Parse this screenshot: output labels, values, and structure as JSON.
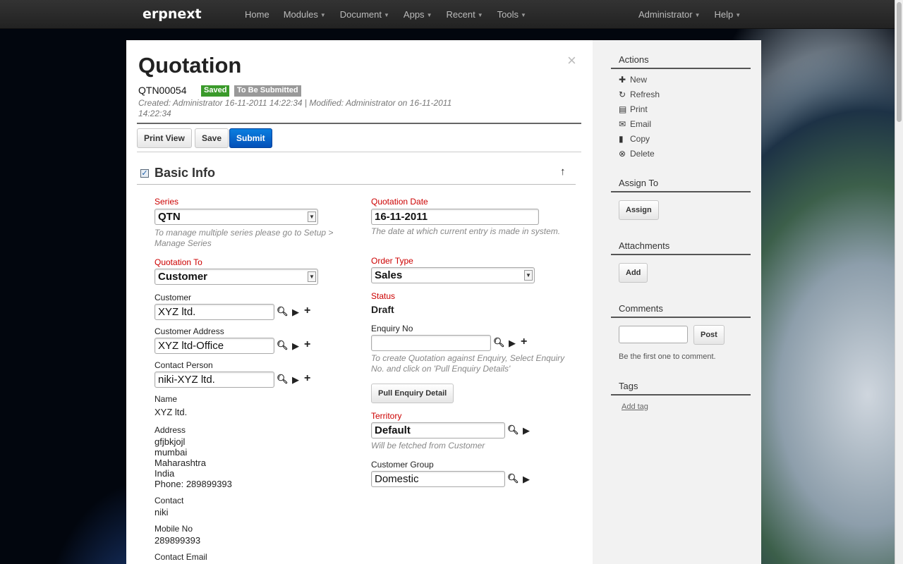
{
  "app": {
    "brand": "erpnext",
    "nav_left": [
      "Home",
      "Modules",
      "Document",
      "Apps",
      "Recent",
      "Tools"
    ],
    "nav_right": [
      "Administrator",
      "Help"
    ]
  },
  "doc": {
    "title": "Quotation",
    "name": "QTN00054",
    "status_saved": "Saved",
    "status_next": "To Be Submitted",
    "meta": "Created: Administrator 16-11-2011 14:22:34 | Modified: Administrator on 16-11-2011 14:22:34",
    "buttons": {
      "print_view": "Print View",
      "save": "Save",
      "submit": "Submit"
    },
    "section_title": "Basic Info"
  },
  "left": {
    "series_label": "Series",
    "series_value": "QTN",
    "series_hint": "To manage multiple series please go to Setup > Manage Series",
    "quotation_to_label": "Quotation To",
    "quotation_to_value": "Customer",
    "customer_label": "Customer",
    "customer_value": "XYZ ltd.",
    "customer_address_label": "Customer Address",
    "customer_address_value": "XYZ ltd-Office",
    "contact_person_label": "Contact Person",
    "contact_person_value": "niki-XYZ ltd.",
    "name_label": "Name",
    "name_value": "XYZ ltd.",
    "address_label": "Address",
    "address_lines": [
      "gfjbkjojl",
      "mumbai",
      "Maharashtra",
      "India",
      "Phone: 289899393"
    ],
    "contact_label": "Contact",
    "contact_value": "niki",
    "mobile_label": "Mobile No",
    "mobile_value": "289899393",
    "contact_email_label": "Contact Email"
  },
  "right": {
    "quotation_date_label": "Quotation Date",
    "quotation_date_value": "16-11-2011",
    "quotation_date_hint": "The date at which current entry is made in system.",
    "order_type_label": "Order Type",
    "order_type_value": "Sales",
    "status_label": "Status",
    "status_value": "Draft",
    "enquiry_no_label": "Enquiry No",
    "enquiry_no_value": "",
    "enquiry_hint": "To create Quotation against Enquiry, Select Enquiry No. and click on 'Pull Enquiry Details'",
    "pull_button": "Pull Enquiry Detail",
    "territory_label": "Territory",
    "territory_value": "Default",
    "territory_hint": "Will be fetched from Customer",
    "customer_group_label": "Customer Group",
    "customer_group_value": "Domestic"
  },
  "sidebar": {
    "actions_title": "Actions",
    "actions": [
      {
        "icon": "plus-icon",
        "label": "New"
      },
      {
        "icon": "refresh-icon",
        "label": "Refresh"
      },
      {
        "icon": "print-icon",
        "label": "Print"
      },
      {
        "icon": "envelope-icon",
        "label": "Email"
      },
      {
        "icon": "file-icon",
        "label": "Copy"
      },
      {
        "icon": "remove-icon",
        "label": "Delete"
      }
    ],
    "assign_title": "Assign To",
    "assign_button": "Assign",
    "attachments_title": "Attachments",
    "attach_button": "Add",
    "comments_title": "Comments",
    "post_button": "Post",
    "comments_note": "Be the first one to comment.",
    "tags_title": "Tags",
    "add_tag": "Add tag"
  }
}
